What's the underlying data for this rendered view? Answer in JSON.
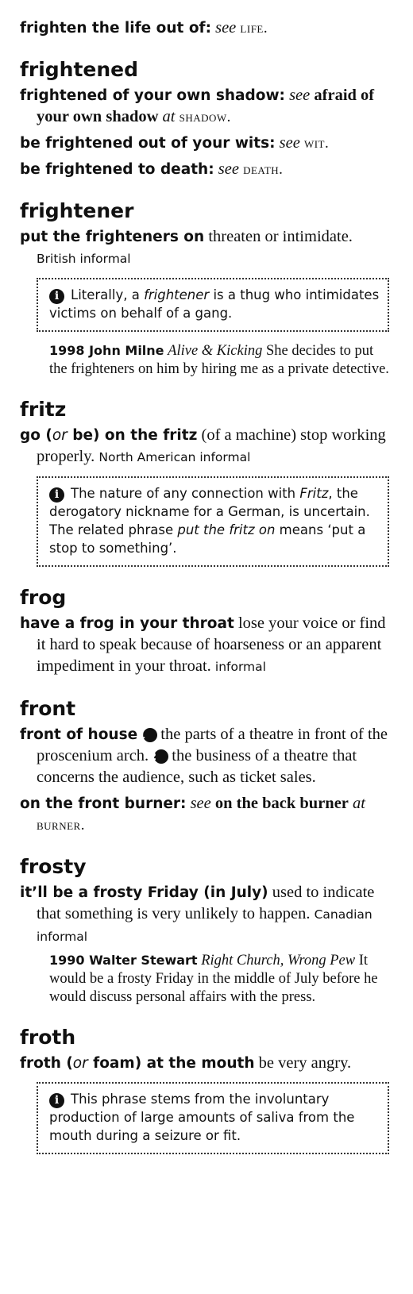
{
  "top": {
    "phrase": "frighten the life out of",
    "see": "see",
    "ref": "life."
  },
  "frightened": {
    "headword": "frightened",
    "p1": {
      "phrase": "frightened of your own shadow",
      "see": "see",
      "target": "afraid of your own shadow",
      "at": "at",
      "ref": "shadow."
    },
    "p2": {
      "phrase": "be frightened out of your wits",
      "see": "see",
      "ref": "wit."
    },
    "p3": {
      "phrase": "be frightened to death",
      "see": "see",
      "ref": "death."
    }
  },
  "frightener": {
    "headword": "frightener",
    "phrase": "put the frighteners on",
    "definition": "threaten or intimidate.",
    "register": "British informal",
    "note": {
      "pre": "Literally, a ",
      "em": "frightener",
      "post": " is a thug who intimidates victims on behalf of a gang."
    },
    "quote": {
      "author": "1998 John Milne",
      "source": "Alive & Kicking",
      "text": "She decides to put the frighteners on him by hiring me as a private detective."
    }
  },
  "fritz": {
    "headword": "fritz",
    "phrase_a": "go (",
    "or": "or",
    "phrase_b": " be) on the fritz",
    "definition": "(of a machine) stop working properly.",
    "register": "North American informal",
    "note": {
      "pre": "The nature of any connection with ",
      "em1": "Fritz",
      "mid": ", the derogatory nickname for a German, is uncertain. The related phrase ",
      "em2": "put the fritz on",
      "post": " means ‘put a stop to something’."
    }
  },
  "frog": {
    "headword": "frog",
    "phrase": "have a frog in your throat",
    "definition": "lose your voice or find it hard to speak because of hoarseness or an apparent impediment in your throat.",
    "register": "informal"
  },
  "front": {
    "headword": "front",
    "p1": {
      "phrase": "front of house",
      "num1": "1",
      "sense1": "the parts of a theatre in front of the proscenium arch.",
      "num2": "2",
      "sense2": "the business of a theatre that concerns the audience, such as ticket sales."
    },
    "p2": {
      "phrase": "on the front burner",
      "see": "see",
      "target": "on the back burner",
      "at": "at",
      "ref": "burner."
    }
  },
  "frosty": {
    "headword": "frosty",
    "phrase": "it’ll be a frosty Friday (in July)",
    "definition": "used to indicate that something is very unlikely to happen.",
    "register": "Canadian informal",
    "quote": {
      "author": "1990 Walter Stewart",
      "source": "Right Church, Wrong Pew",
      "text": "It would be a frosty Friday in the middle of July before he would discuss personal affairs with the press."
    }
  },
  "froth": {
    "headword": "froth",
    "phrase_a": "froth (",
    "or": "or",
    "phrase_b": " foam) at the mouth",
    "definition": "be very angry.",
    "note": "This phrase stems from the involuntary production of large amounts of saliva from the mouth during a seizure or fit."
  },
  "icons": {
    "info": "info-circle-icon",
    "number": "numbered-circle-icon"
  }
}
